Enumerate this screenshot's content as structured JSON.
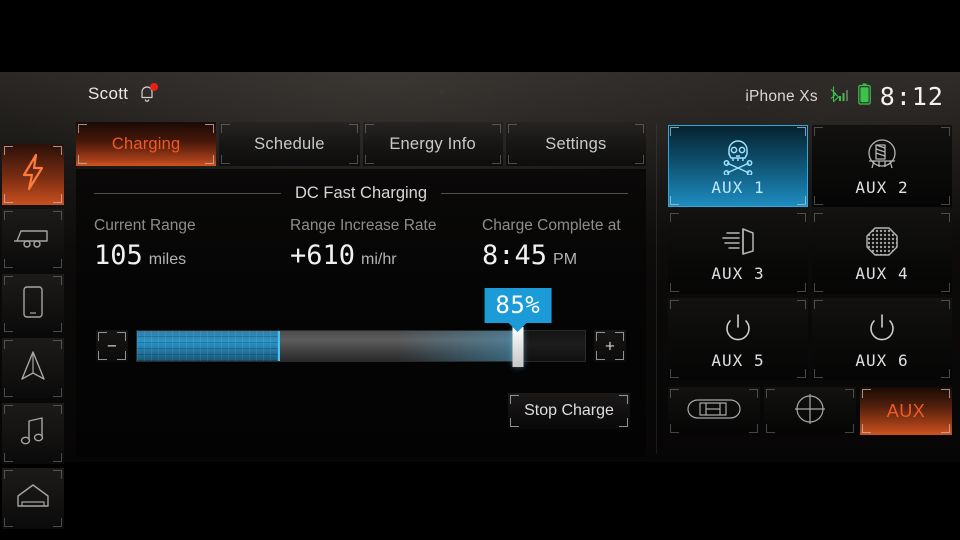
{
  "status_bar": {
    "user_name": "Scott",
    "notification_icon": "bell-icon",
    "has_notification": true,
    "device_name": "iPhone Xs",
    "bluetooth_icon": "bluetooth-signal-icon",
    "battery_icon": "battery-icon",
    "clock": "8:12"
  },
  "sidebar": {
    "items": [
      {
        "name": "sidebar-item-charging",
        "icon": "lightning-bolt-icon",
        "active": true
      },
      {
        "name": "sidebar-item-trailer",
        "icon": "trailer-icon",
        "active": false
      },
      {
        "name": "sidebar-item-phone",
        "icon": "phone-icon",
        "active": false
      },
      {
        "name": "sidebar-item-navigation",
        "icon": "navigation-arrow-icon",
        "active": false
      },
      {
        "name": "sidebar-item-audio",
        "icon": "music-note-icon",
        "active": false
      },
      {
        "name": "sidebar-item-home",
        "icon": "home-icon",
        "active": false
      }
    ]
  },
  "tabs": [
    {
      "label": "Charging",
      "active": true
    },
    {
      "label": "Schedule",
      "active": false
    },
    {
      "label": "Energy Info",
      "active": false
    },
    {
      "label": "Settings",
      "active": false
    }
  ],
  "charging": {
    "section_title": "DC Fast Charging",
    "stats": [
      {
        "label": "Current Range",
        "value": "105",
        "unit": "miles"
      },
      {
        "label": "Range Increase Rate",
        "value": "+610",
        "unit": "mi/hr"
      },
      {
        "label": "Charge Complete at",
        "value": "8:45",
        "unit": "PM"
      }
    ],
    "slider": {
      "decrease_label": "−",
      "increase_label": "+",
      "target_percent": 85,
      "target_label": "85%",
      "current_charge_percent": 32
    },
    "stop_button_label": "Stop Charge"
  },
  "aux_panel": {
    "buttons": [
      {
        "label": "AUX 1",
        "icon": "skull-crossbones-icon",
        "active": true
      },
      {
        "label": "AUX 2",
        "icon": "winch-icon",
        "active": false
      },
      {
        "label": "AUX 3",
        "icon": "light-beam-icon",
        "active": false
      },
      {
        "label": "AUX 4",
        "icon": "mesh-grille-icon",
        "active": false
      },
      {
        "label": "AUX 5",
        "icon": "power-icon",
        "active": false
      },
      {
        "label": "AUX 6",
        "icon": "power-icon",
        "active": false
      }
    ],
    "bottom_row": [
      {
        "label": "",
        "icon": "car-top-view-icon",
        "active": false
      },
      {
        "label": "",
        "icon": "crosshair-icon",
        "active": false
      },
      {
        "label": "AUX",
        "icon": "",
        "active": true
      }
    ]
  },
  "colors": {
    "accent_orange": "#ef5a26",
    "accent_blue": "#1b9bd8",
    "fill_blue": "#2b93c6",
    "battery_green": "#3cc24a",
    "notification_red": "#e8201a"
  }
}
